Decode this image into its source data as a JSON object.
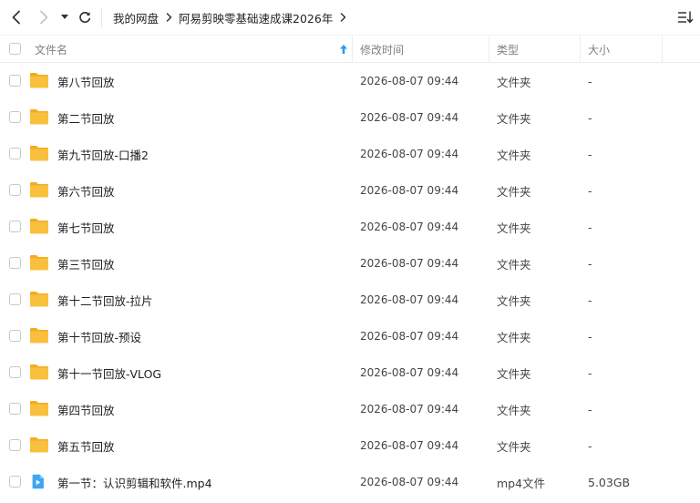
{
  "breadcrumb": {
    "items": [
      "我的网盘",
      "阿易剪映零基础速成课2026年"
    ]
  },
  "columns": {
    "name": "文件名",
    "modified": "修改时间",
    "type": "类型",
    "size": "大小"
  },
  "files": [
    {
      "name": "第八节回放",
      "modified": "2026-08-07 09:44",
      "type": "文件夹",
      "size": "-",
      "icon": "folder-icon"
    },
    {
      "name": "第二节回放",
      "modified": "2026-08-07 09:44",
      "type": "文件夹",
      "size": "-",
      "icon": "folder-icon"
    },
    {
      "name": "第九节回放-口播2",
      "modified": "2026-08-07 09:44",
      "type": "文件夹",
      "size": "-",
      "icon": "folder-icon"
    },
    {
      "name": "第六节回放",
      "modified": "2026-08-07 09:44",
      "type": "文件夹",
      "size": "-",
      "icon": "folder-icon"
    },
    {
      "name": "第七节回放",
      "modified": "2026-08-07 09:44",
      "type": "文件夹",
      "size": "-",
      "icon": "folder-icon"
    },
    {
      "name": "第三节回放",
      "modified": "2026-08-07 09:44",
      "type": "文件夹",
      "size": "-",
      "icon": "folder-icon"
    },
    {
      "name": "第十二节回放-拉片",
      "modified": "2026-08-07 09:44",
      "type": "文件夹",
      "size": "-",
      "icon": "folder-icon"
    },
    {
      "name": "第十节回放-预设",
      "modified": "2026-08-07 09:44",
      "type": "文件夹",
      "size": "-",
      "icon": "folder-icon"
    },
    {
      "name": "第十一节回放-VLOG",
      "modified": "2026-08-07 09:44",
      "type": "文件夹",
      "size": "-",
      "icon": "folder-icon"
    },
    {
      "name": "第四节回放",
      "modified": "2026-08-07 09:44",
      "type": "文件夹",
      "size": "-",
      "icon": "folder-icon"
    },
    {
      "name": "第五节回放",
      "modified": "2026-08-07 09:44",
      "type": "文件夹",
      "size": "-",
      "icon": "folder-icon"
    },
    {
      "name": "第一节：认识剪辑和软件.mp4",
      "modified": "2026-08-07 09:44",
      "type": "mp4文件",
      "size": "5.03GB",
      "icon": "video-file-icon"
    }
  ],
  "colors": {
    "folder": "#f9c03d",
    "folder_back": "#f3ac22",
    "video": "#3ea6f2",
    "sort_arrow": "#2b9af3"
  }
}
